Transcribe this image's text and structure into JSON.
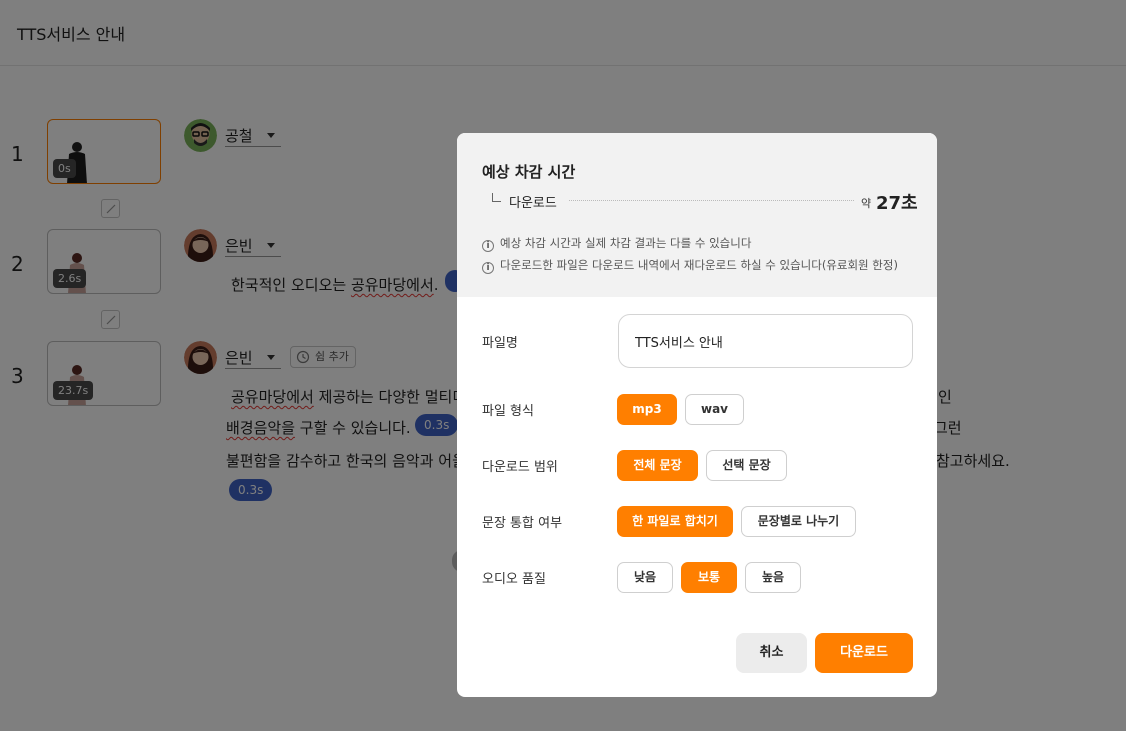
{
  "header": {
    "title": "TTS서비스 안내"
  },
  "rows": [
    {
      "num": "1",
      "duration": "0s",
      "speaker": "공철"
    },
    {
      "num": "2",
      "duration": "2.6s",
      "speaker": "은빈"
    },
    {
      "num": "3",
      "duration": "23.7s",
      "speaker": "은빈",
      "rest_label": "쉼 추가"
    }
  ],
  "sentences": {
    "row2_prefix": "한국적인 오디오는 ",
    "row2_squiggle": "공유마당에서",
    "row2_suffix": ".",
    "row3_line1_squiggle": "공유마당에서",
    "row3_line1": " 제공하는 다양한 멀티미",
    "row3_line1_right": "인",
    "row3_line2_squiggle": "배경음악을",
    "row3_line2": " 구할 수 있습니다.",
    "row3_line2_right": "그런",
    "row3_line3": "불편함을 감수하고 한국의 음악과 어울",
    "row3_line3_right": "참고하세요.",
    "pause_a": "0.3s",
    "pause_b": "0.3s"
  },
  "modal": {
    "title": "예상 차감 시간",
    "estimate_label": "다운로드",
    "estimate_approx": "약",
    "estimate_value": "27초",
    "note1": "예상 차감 시간과 실제 차감 결과는 다를 수 있습니다",
    "note2": "다운로드한 파일은 다운로드 내역에서 재다운로드 하실 수 있습니다(유료회원 한정)",
    "fields": {
      "filename_label": "파일명",
      "filename_value": "TTS서비스 안내",
      "format_label": "파일 형식",
      "format_options": [
        "mp3",
        "wav"
      ],
      "range_label": "다운로드 범위",
      "range_options": [
        "전체 문장",
        "선택 문장"
      ],
      "merge_label": "문장 통합 여부",
      "merge_options": [
        "한 파일로 합치기",
        "문장별로 나누기"
      ],
      "quality_label": "오디오 품질",
      "quality_options": [
        "낮음",
        "보통",
        "높음"
      ]
    },
    "cancel_label": "취소",
    "download_label": "다운로드"
  },
  "colors": {
    "accent": "#ff7f00",
    "pause_badge": "#3f63c7",
    "overlay": "rgba(0,0,0,0.5)"
  }
}
